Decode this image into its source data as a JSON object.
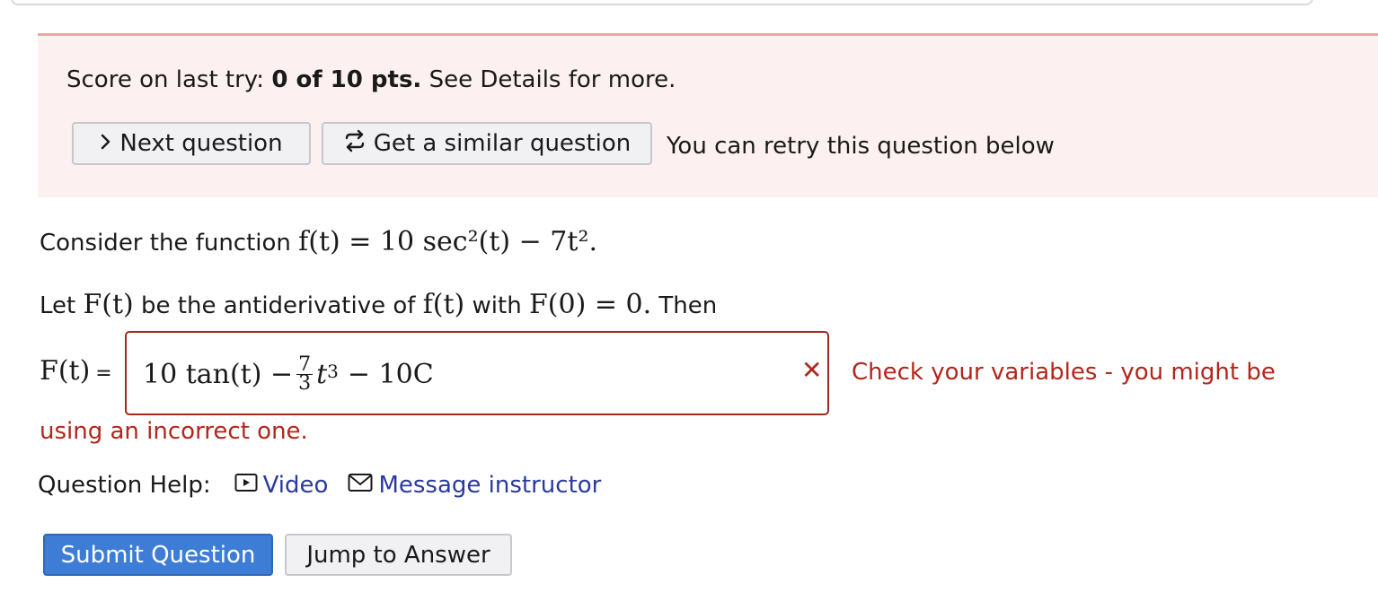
{
  "score": {
    "prefix": "Score on last try: ",
    "value": "0 of 10 pts.",
    "suffix": " See Details for more."
  },
  "buttons": {
    "next_label": "Next question",
    "similar_label": "Get a similar question",
    "submit_label": "Submit Question",
    "jump_label": "Jump to Answer"
  },
  "retry_text": "You can retry this question below",
  "question": {
    "line1_text": "Consider the function ",
    "line1_math": "f(t) = 10 sec²(t) − 7t².",
    "line2_a": "Let ",
    "line2_F": "F(t)",
    "line2_b": " be the antiderivative of ",
    "line2_f": "f(t)",
    "line2_c": " with ",
    "line2_cond": "F(0) = 0.",
    "line2_d": " Then"
  },
  "answer": {
    "label": "F(t)",
    "equals": "=",
    "part1": "10 tan(t) −",
    "frac_num": "7",
    "frac_den": "3",
    "part2": "t",
    "exp": "3",
    "part3": "− 10C"
  },
  "error": {
    "mark": "✕",
    "line1": "Check your variables - you might be",
    "line2": "using an incorrect one."
  },
  "help": {
    "label": "Question Help:",
    "video": "Video",
    "message": "Message instructor"
  },
  "colors": {
    "error": "#b2261c",
    "link": "#2a3a9e",
    "submit_bg": "#3e7dd6",
    "panel_bg": "#fcf0f0"
  }
}
